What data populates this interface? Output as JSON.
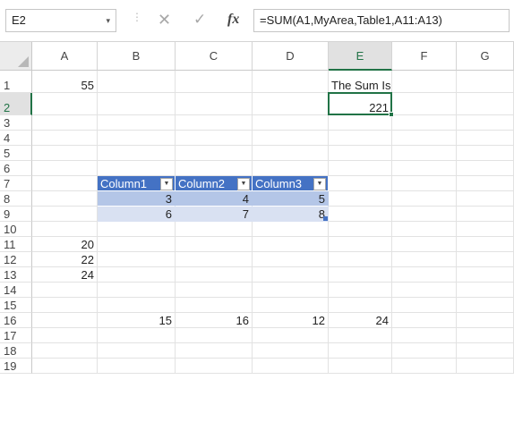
{
  "name_box": {
    "value": "E2",
    "arrow_icon": "dropdown-arrow-icon"
  },
  "formula_bar": {
    "separator": "⋮",
    "cancel_icon": "✕",
    "enter_icon": "✓",
    "fx_label": "fx",
    "formula": "=SUM(A1,MyArea,Table1,A11:A13)"
  },
  "columns": [
    "A",
    "B",
    "C",
    "D",
    "E",
    "F",
    "G"
  ],
  "selected_column": "E",
  "rows": [
    "1",
    "2",
    "3",
    "4",
    "5",
    "6",
    "7",
    "8",
    "9",
    "10",
    "11",
    "12",
    "13",
    "14",
    "15",
    "16",
    "17",
    "18",
    "19"
  ],
  "selected_row": "2",
  "cells": {
    "A1": "55",
    "E1": "The Sum Is",
    "E2": "221",
    "A11": "20",
    "A12": "22",
    "A13": "24",
    "B16": "15",
    "C16": "16",
    "D16": "12",
    "E16": "24"
  },
  "table": {
    "name": "Table1",
    "headers": [
      "Column1",
      "Column2",
      "Column3"
    ],
    "rows": [
      [
        "3",
        "4",
        "5"
      ],
      [
        "6",
        "7",
        "8"
      ]
    ],
    "header_color": "#4472c4",
    "band1_color": "#b4c6e7",
    "band2_color": "#d9e1f2",
    "filter_icon": "▼"
  },
  "colors": {
    "accent": "#217346",
    "grid_line": "#e2e2e2",
    "header_bg_selected": "#e1e1e1"
  }
}
